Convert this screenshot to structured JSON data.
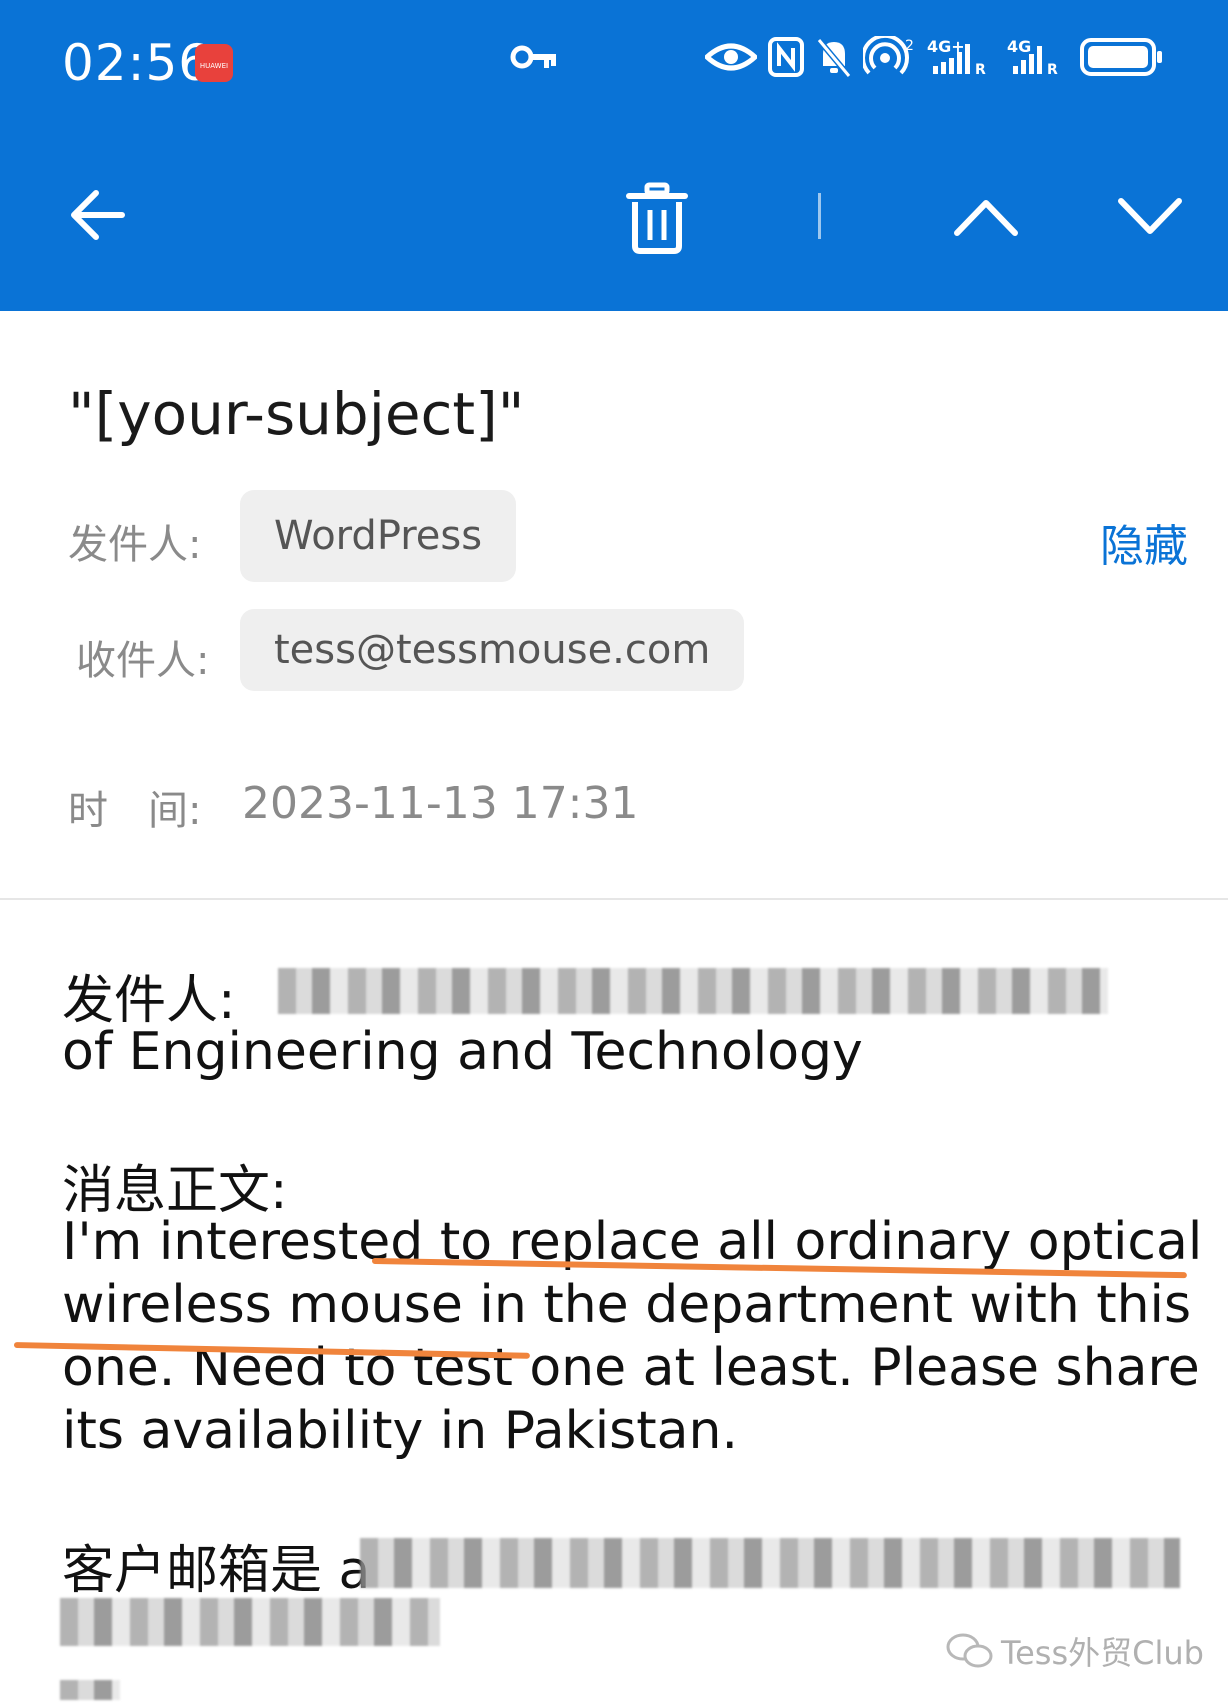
{
  "status_bar": {
    "time": "02:56",
    "app_badge": "HUAWEI",
    "signal_1": "4G+",
    "signal_2": "4G"
  },
  "toolbar": {
    "back_icon": "arrow-left-icon",
    "delete_icon": "trash-icon",
    "prev_icon": "chevron-up-icon",
    "next_icon": "chevron-down-icon"
  },
  "email": {
    "subject": "\"[your-subject]\"",
    "from_label": "发件人:",
    "from_value": "WordPress",
    "hide_label": "隐藏",
    "to_label": "收件人:",
    "to_value": "tess@tessmouse.com",
    "time_label": "时　间:",
    "time_value": "2023-11-13 17:31"
  },
  "body": {
    "sender_label": "发件人:",
    "sender_line2": "of Engineering and Technology",
    "message_label": "消息正文:",
    "message_lines": [
      "I'm interested to replace all ordinary optical",
      "wireless mouse in the department with this",
      "one. Need to test one at least. Please share",
      "its availability in Pakistan."
    ],
    "customer_email_label": "客户邮箱是 a"
  },
  "watermark": "Tess外贸Club",
  "colors": {
    "header_blue": "#0a73d6",
    "link_blue": "#0a73d6",
    "highlight_orange": "#f0843c"
  }
}
